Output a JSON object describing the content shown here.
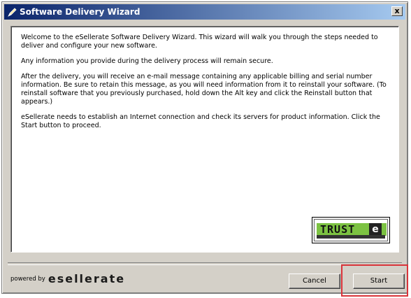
{
  "window": {
    "title": "Software Delivery Wizard",
    "close_label": "x"
  },
  "content": {
    "paragraphs": [
      "Welcome to the eSellerate Software Delivery Wizard. This wizard will walk you through the steps needed to deliver and configure your new software.",
      "Any information you provide during the delivery process will remain secure.",
      "After the delivery, you will receive an e-mail message containing any applicable billing and serial number information. Be sure to retain this message, as you will need information from it to reinstall your software. (To reinstall software that you previously purchased, hold down the Alt key and click the Reinstall button that appears.)",
      "eSellerate needs to establish an Internet connection and check its servers for product information. Click the Start button to proceed."
    ],
    "trust_badge": {
      "word": "TRUST",
      "mark": "e"
    }
  },
  "footer": {
    "powered_by_label": "powered by",
    "brand": "esellerate",
    "cancel_label": "Cancel",
    "start_label": "Start"
  },
  "colors": {
    "titlebar_start": "#0a246a",
    "titlebar_end": "#a6caf0",
    "highlight": "#d9343a",
    "trust_green": "#7cc242"
  },
  "icons": {
    "title_icon": "pencil-icon",
    "close_icon": "close-icon"
  }
}
